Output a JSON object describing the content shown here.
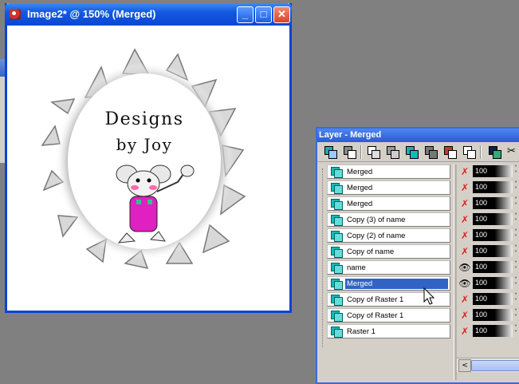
{
  "image_window": {
    "title": "Image2* @ 150% (Merged)",
    "buttons": {
      "minimize": "_",
      "maximize": "□",
      "close": "✕"
    },
    "canvas": {
      "text_line1": "Designs",
      "text_line2": "by Joy"
    }
  },
  "layer_palette": {
    "title": "Layer - Merged",
    "toolbar_icons": [
      "new-raster-layer-icon",
      "duplicate-layer-icon",
      "new-vector-layer-icon",
      "new-group-icon",
      "merge-layers-icon",
      "merge-down-icon",
      "delete-layer-icon",
      "rename-layer-icon",
      "layer-properties-icon",
      "cut-icon"
    ],
    "layers": [
      {
        "name": "Merged",
        "visible": false,
        "opacity": "100",
        "selected": false
      },
      {
        "name": "Merged",
        "visible": false,
        "opacity": "100",
        "selected": false
      },
      {
        "name": "Merged",
        "visible": false,
        "opacity": "100",
        "selected": false
      },
      {
        "name": "Copy (3) of name",
        "visible": false,
        "opacity": "100",
        "selected": false
      },
      {
        "name": "Copy (2) of name",
        "visible": false,
        "opacity": "100",
        "selected": false
      },
      {
        "name": "Copy of name",
        "visible": false,
        "opacity": "100",
        "selected": false
      },
      {
        "name": "name",
        "visible": true,
        "opacity": "100",
        "selected": false
      },
      {
        "name": "Merged",
        "visible": true,
        "opacity": "100",
        "selected": true
      },
      {
        "name": "Copy of Raster 1",
        "visible": false,
        "opacity": "100",
        "selected": false
      },
      {
        "name": "Copy of Raster 1",
        "visible": false,
        "opacity": "100",
        "selected": false
      },
      {
        "name": "Raster 1",
        "visible": false,
        "opacity": "100",
        "selected": false
      }
    ]
  },
  "colors": {
    "titlebar_blue": "#0a47d2",
    "selection_blue": "#3163c5",
    "panel_gray": "#d4d0c8",
    "desktop_gray": "#808080",
    "overall_pink": "#e020c0"
  }
}
